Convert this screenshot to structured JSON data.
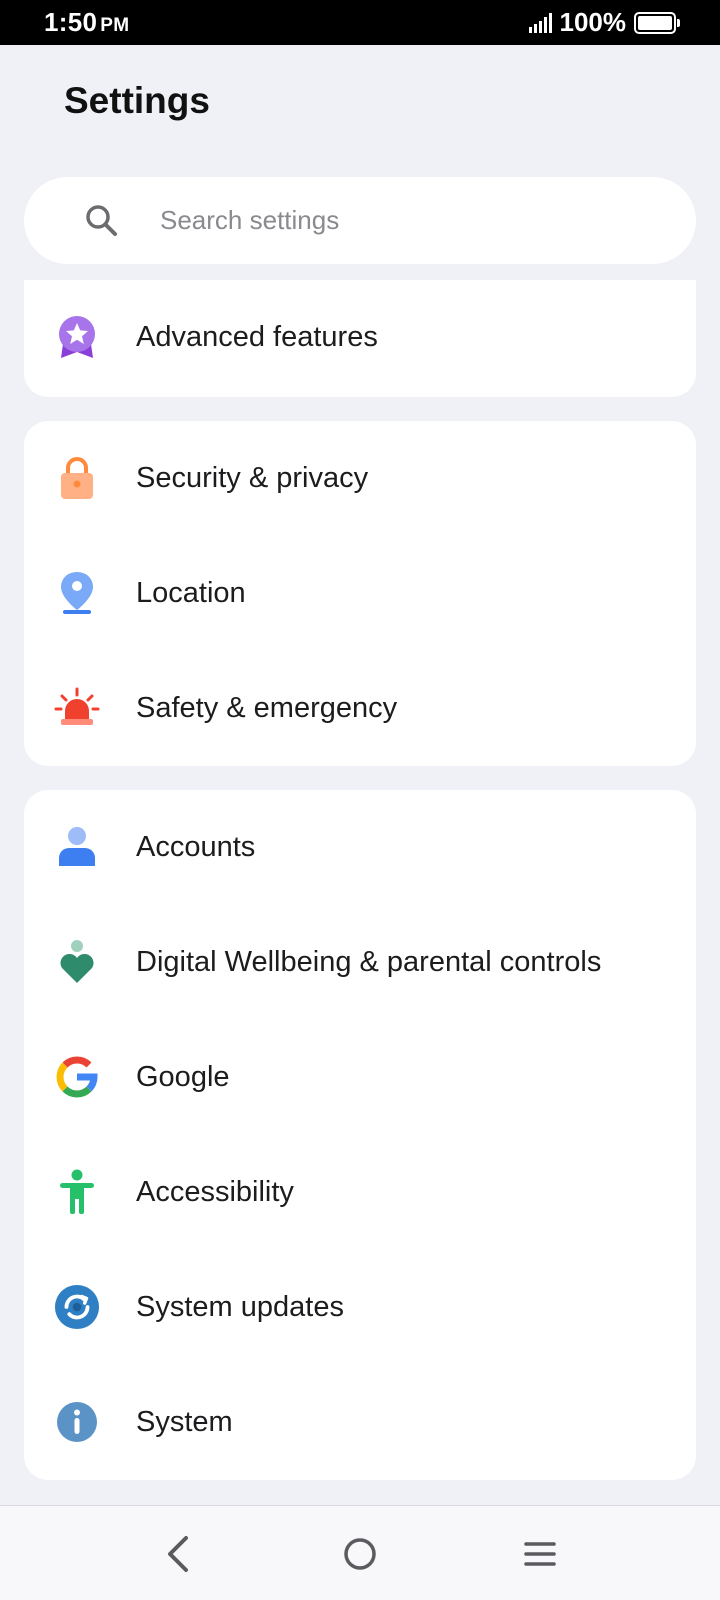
{
  "status_bar": {
    "time": "1:50",
    "ampm": "PM",
    "battery_percent": "100%",
    "battery_level": 1.0
  },
  "header": {
    "title": "Settings"
  },
  "search": {
    "placeholder": "Search settings",
    "icon": "search-icon"
  },
  "groups": [
    {
      "items": [
        {
          "label": "Advanced features",
          "icon": "advanced-features-icon",
          "color": "#9b5de5"
        }
      ]
    },
    {
      "items": [
        {
          "label": "Security & privacy",
          "icon": "lock-icon",
          "color": "#ff9a5c"
        },
        {
          "label": "Location",
          "icon": "location-pin-icon",
          "color": "#4f8ef7"
        },
        {
          "label": "Safety & emergency",
          "icon": "emergency-alarm-icon",
          "color": "#f0412f"
        }
      ]
    },
    {
      "items": [
        {
          "label": "Accounts",
          "icon": "account-person-icon",
          "color": "#3d7ff0"
        },
        {
          "label": "Digital Wellbeing & parental controls",
          "icon": "wellbeing-heart-icon",
          "color": "#2e8b6b"
        },
        {
          "label": "Google",
          "icon": "google-g-icon",
          "color": "#4285f4"
        },
        {
          "label": "Accessibility",
          "icon": "accessibility-person-icon",
          "color": "#27c06a"
        },
        {
          "label": "System updates",
          "icon": "system-update-icon",
          "color": "#2f7fc4"
        },
        {
          "label": "System",
          "icon": "info-icon",
          "color": "#5b93c7"
        }
      ]
    }
  ],
  "nav": {
    "back": "back-icon",
    "home": "home-icon",
    "menu": "menu-icon"
  }
}
